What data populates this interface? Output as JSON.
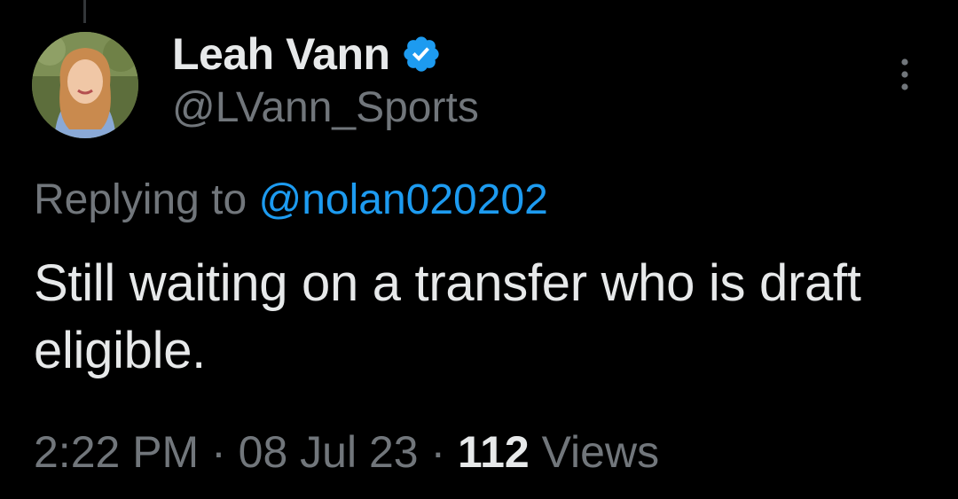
{
  "tweet": {
    "display_name": "Leah Vann",
    "handle": "@LVann_Sports",
    "verified": true,
    "avatar": "user-avatar-photo",
    "reply_prefix": "Replying to ",
    "reply_mention": "@nolan020202",
    "text": "Still waiting on a transfer who is draft eligible.",
    "time": "2:22 PM",
    "separator": " · ",
    "date": "08 Jul 23",
    "views_count": "112",
    "views_label": " Views"
  },
  "icons": {
    "verified": "verified-badge-icon",
    "more": "more-options-icon"
  },
  "colors": {
    "background": "#000000",
    "primary_text": "#e7e9ea",
    "secondary_text": "#71767b",
    "accent": "#1d9bf0"
  }
}
